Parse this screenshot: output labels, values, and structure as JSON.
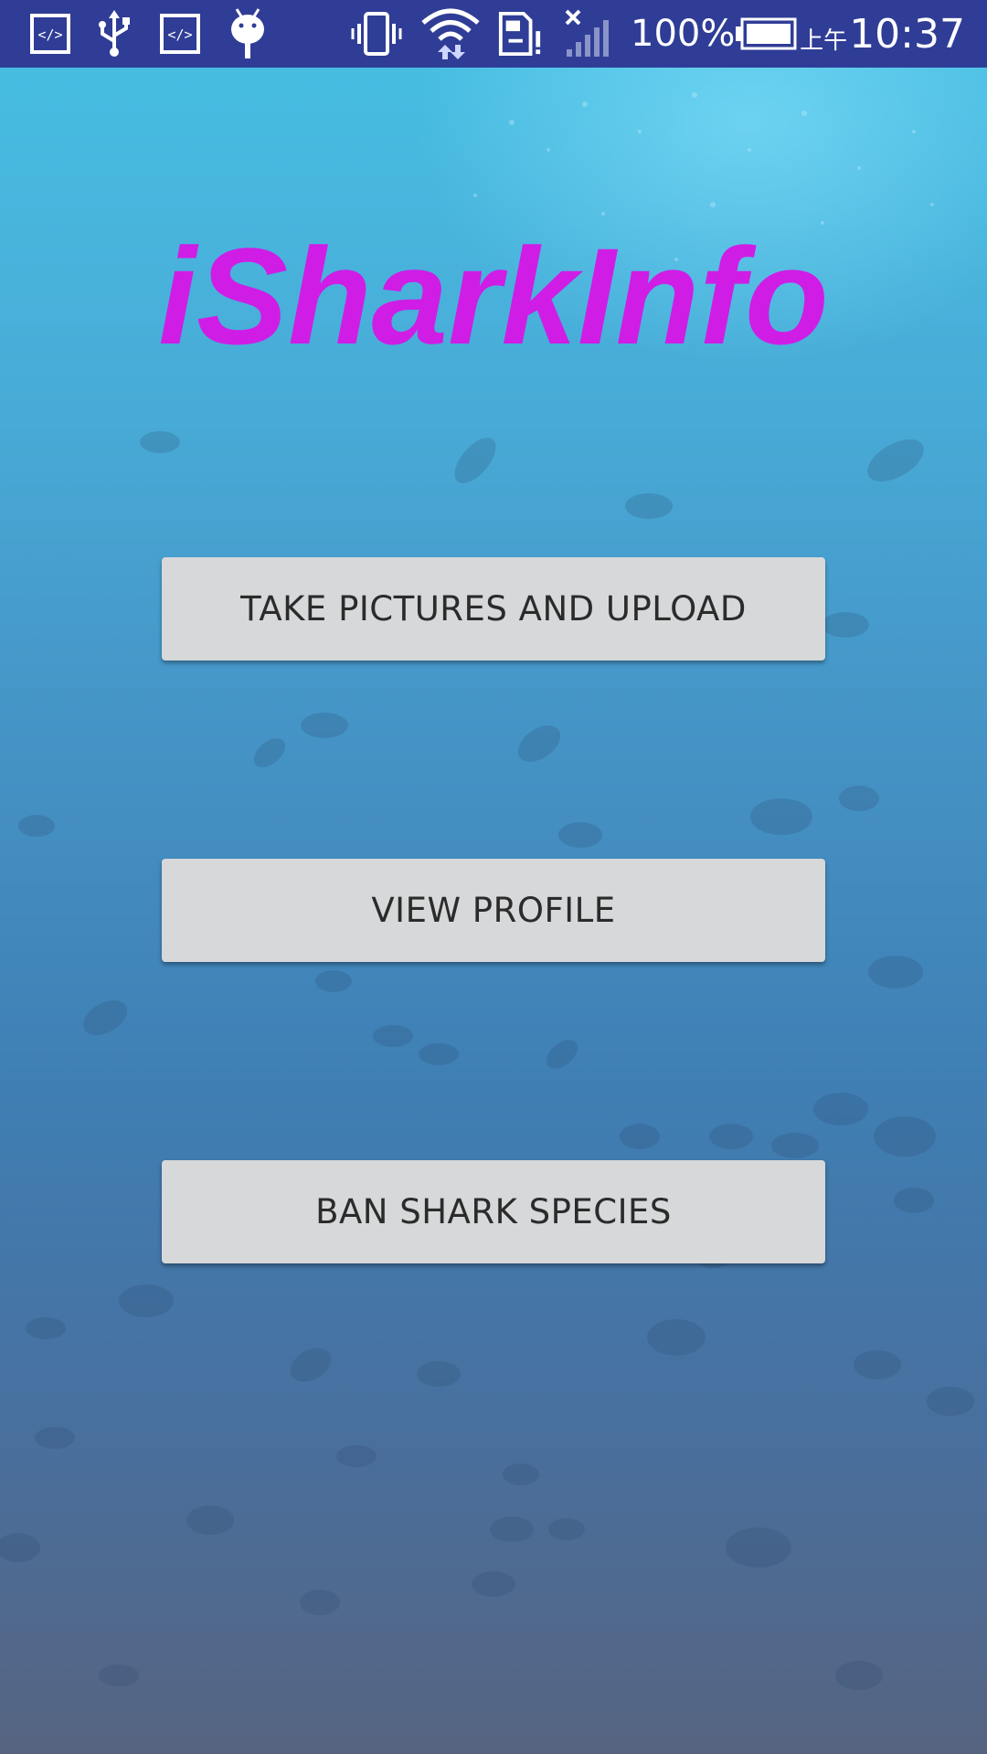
{
  "status_bar": {
    "icons": [
      "code-icon",
      "usb-icon",
      "code-icon",
      "android-debug-icon",
      "vibrate-icon",
      "wifi-icon",
      "sd-card-alert-icon",
      "signal-no-sim-icon",
      "battery-icon"
    ],
    "battery_percent": "100%",
    "clock_ampm": "上午",
    "clock_time": "10:37",
    "background_color": "#2f3d96"
  },
  "app": {
    "title": "iSharkInfo",
    "title_color": "#cf1de6",
    "buttons": [
      {
        "label": "TAKE PICTURES AND UPLOAD"
      },
      {
        "label": "VIEW PROFILE"
      },
      {
        "label": "BAN SHARK SPECIES"
      }
    ],
    "background": "underwater-fish-photo"
  }
}
